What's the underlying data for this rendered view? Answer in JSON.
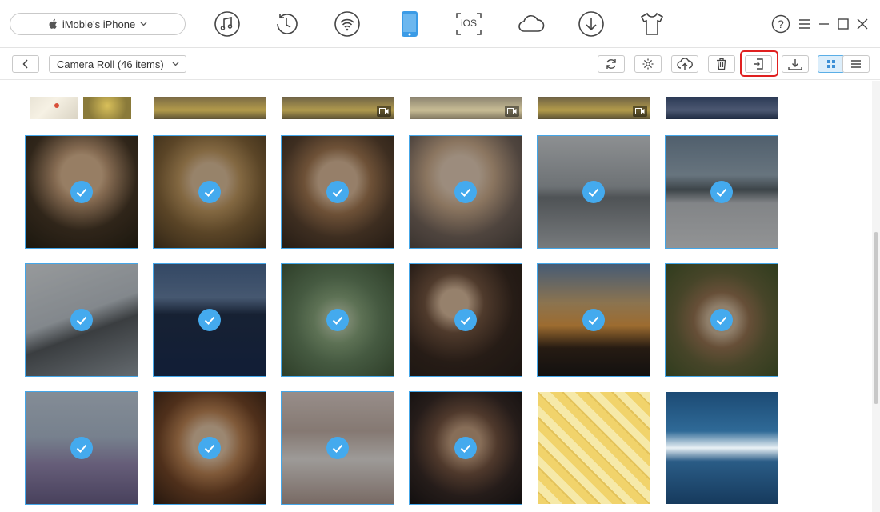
{
  "device": {
    "name": "iMobie's iPhone"
  },
  "nav_icons": [
    "music-icon",
    "history-icon",
    "wifi-icon",
    "phone-icon",
    "ios-icon",
    "cloud-icon",
    "download-icon",
    "tshirt-icon"
  ],
  "nav_ios_label": "iOS",
  "window_controls": {
    "help": "?"
  },
  "toolbar": {
    "album_label": "Camera Roll (46 items)"
  },
  "colors": {
    "accent": "#44aaee",
    "highlight": "#e02020",
    "phone_active": "#3b9be6"
  },
  "photos": [
    {
      "name": "woman-tank-top",
      "selected": true
    },
    {
      "name": "woman-long-hair",
      "selected": true
    },
    {
      "name": "woman-hand-face",
      "selected": true
    },
    {
      "name": "woman-watch",
      "selected": true
    },
    {
      "name": "fighter-jet-front",
      "selected": true
    },
    {
      "name": "jets-on-runway",
      "selected": true
    },
    {
      "name": "jet-in-sky",
      "selected": true
    },
    {
      "name": "aircraft-carrier",
      "selected": true
    },
    {
      "name": "succulent",
      "selected": true
    },
    {
      "name": "woman-sitting",
      "selected": true
    },
    {
      "name": "sunset-sea",
      "selected": true
    },
    {
      "name": "bird",
      "selected": true
    },
    {
      "name": "hedgehog-field",
      "selected": true
    },
    {
      "name": "woman-bangs",
      "selected": true
    },
    {
      "name": "dress-rack",
      "selected": true
    },
    {
      "name": "blue-eyes",
      "selected": true
    },
    {
      "name": "yellow-dress",
      "selected": false
    },
    {
      "name": "ocean-waves",
      "selected": false
    }
  ]
}
